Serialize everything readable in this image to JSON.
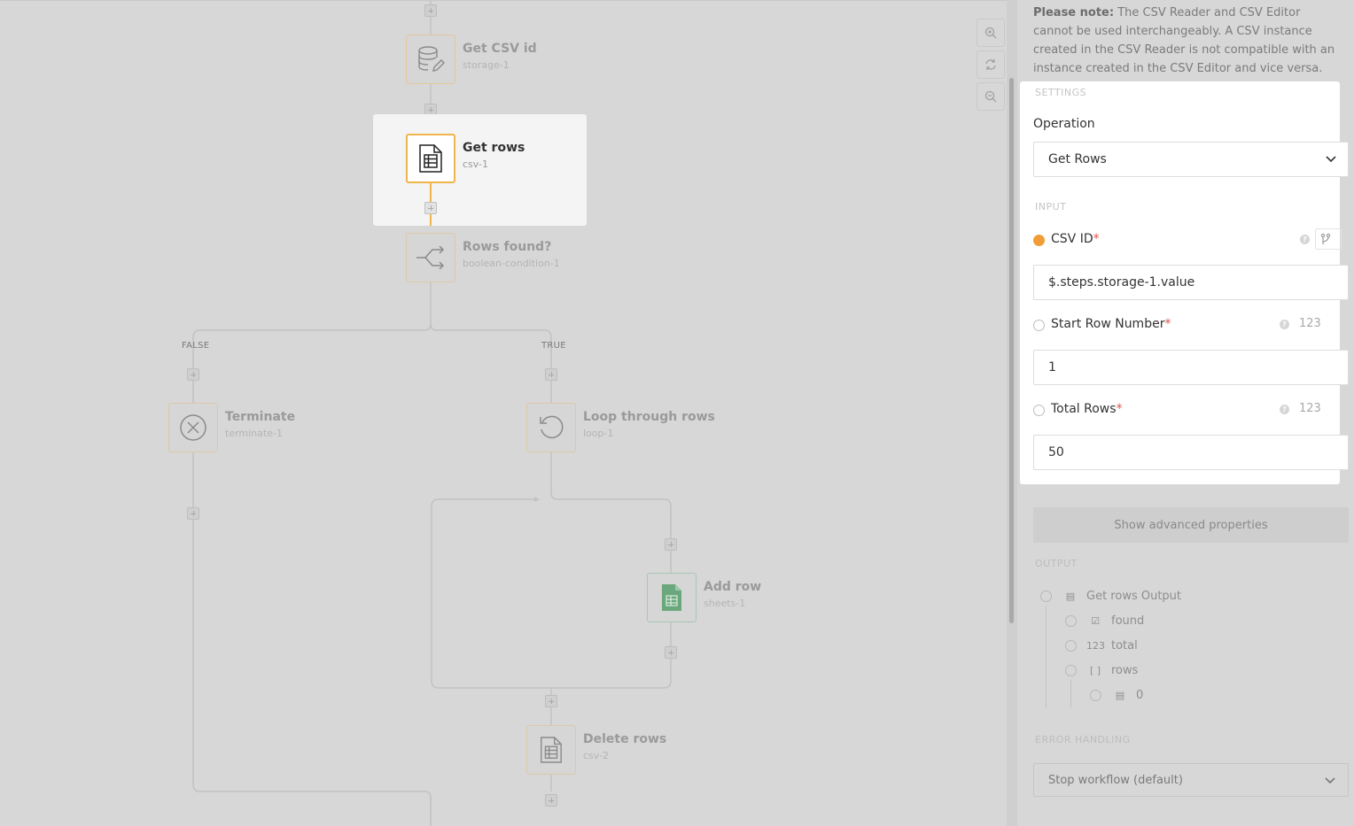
{
  "canvas": {
    "nodes": [
      {
        "id": "get-csv-id",
        "title": "Get CSV id",
        "sub": "storage-1",
        "icon": "database-edit-icon"
      },
      {
        "id": "get-rows",
        "title": "Get rows",
        "sub": "csv-1",
        "icon": "csv-document-icon"
      },
      {
        "id": "rows-found",
        "title": "Rows found?",
        "sub": "boolean-condition-1",
        "icon": "branch-icon"
      },
      {
        "id": "terminate",
        "title": "Terminate",
        "sub": "terminate-1",
        "icon": "close-circle-icon"
      },
      {
        "id": "loop",
        "title": "Loop through rows",
        "sub": "loop-1",
        "icon": "loop-icon"
      },
      {
        "id": "add-row",
        "title": "Add row",
        "sub": "sheets-1",
        "icon": "sheets-icon"
      },
      {
        "id": "delete-rows",
        "title": "Delete rows",
        "sub": "csv-2",
        "icon": "csv-document-icon"
      }
    ],
    "branches": {
      "false_label": "FALSE",
      "true_label": "TRUE"
    },
    "zoom": {
      "zoom_in": "zoom-in-icon",
      "reset": "refresh-icon",
      "zoom_out": "zoom-out-icon"
    }
  },
  "panel": {
    "note": {
      "prefix": "Please note:",
      "text": " The CSV Reader and CSV Editor cannot be used interchangeably. A CSV instance created in the CSV Reader is not compatible with an instance created in the CSV Editor and vice versa."
    },
    "settings": {
      "section": "SETTINGS",
      "operation_label": "Operation",
      "operation_value": "Get Rows"
    },
    "input": {
      "section": "INPUT",
      "fields": [
        {
          "label": "CSV ID",
          "value": "$.steps.storage-1.value",
          "type": "branch"
        },
        {
          "label": "Start Row Number",
          "value": "1",
          "type": "123"
        },
        {
          "label": "Total Rows",
          "value": "50",
          "type": "123"
        }
      ],
      "required_mark": "*"
    },
    "advanced_button": "Show advanced properties",
    "output": {
      "section": "OUTPUT",
      "root": "Get rows Output",
      "children": [
        {
          "icon": "☑",
          "label": "found"
        },
        {
          "icon": "123",
          "label": "total"
        },
        {
          "icon": "[ ]",
          "label": "rows"
        }
      ],
      "grandchild": {
        "icon": "▤",
        "label": "0"
      }
    },
    "error_handling": {
      "section": "ERROR HANDLING",
      "value": "Stop workflow (default)"
    }
  }
}
